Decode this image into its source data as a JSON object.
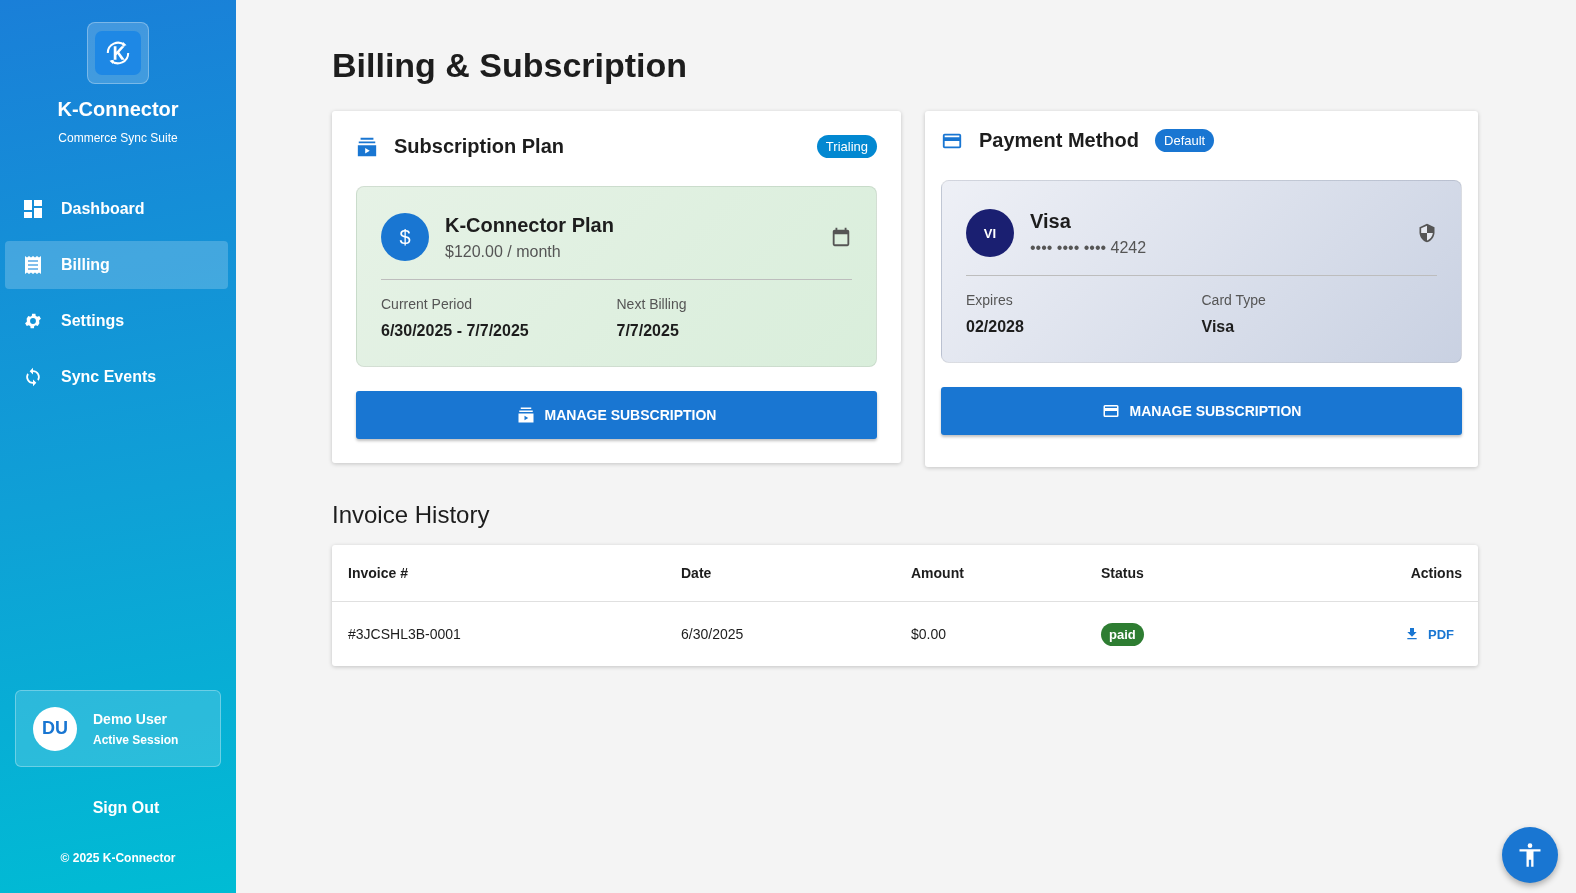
{
  "sidebar": {
    "app_name": "K-Connector",
    "tagline": "Commerce Sync Suite",
    "items": [
      {
        "label": "Dashboard",
        "selected": false
      },
      {
        "label": "Billing",
        "selected": true
      },
      {
        "label": "Settings",
        "selected": false
      },
      {
        "label": "Sync Events",
        "selected": false
      }
    ],
    "user": {
      "initials": "DU",
      "name": "Demo User",
      "status": "Active Session"
    },
    "sign_out": "Sign Out",
    "copyright": "© 2025 K-Connector"
  },
  "page_title": "Billing & Subscription",
  "subscription": {
    "title": "Subscription Plan",
    "badge": "Trialing",
    "plan_name": "K-Connector Plan",
    "price": "$120.00 / month",
    "currency_symbol": "$",
    "fields": [
      {
        "label": "Current Period",
        "value": "6/30/2025 - 7/7/2025"
      },
      {
        "label": "Next Billing",
        "value": "7/7/2025"
      }
    ],
    "button": "MANAGE SUBSCRIPTION"
  },
  "payment": {
    "title": "Payment Method",
    "badge": "Default",
    "brand_initials": "VI",
    "brand": "Visa",
    "number": "•••• •••• •••• 4242",
    "fields": [
      {
        "label": "Expires",
        "value": "02/2028"
      },
      {
        "label": "Card Type",
        "value": "Visa"
      }
    ],
    "button": "MANAGE SUBSCRIPTION"
  },
  "invoices": {
    "title": "Invoice History",
    "columns": [
      "Invoice #",
      "Date",
      "Amount",
      "Status",
      "Actions"
    ],
    "rows": [
      {
        "invoice": "#3JCSHL3B-0001",
        "date": "6/30/2025",
        "amount": "$0.00",
        "status": "paid",
        "action": "PDF"
      }
    ]
  }
}
